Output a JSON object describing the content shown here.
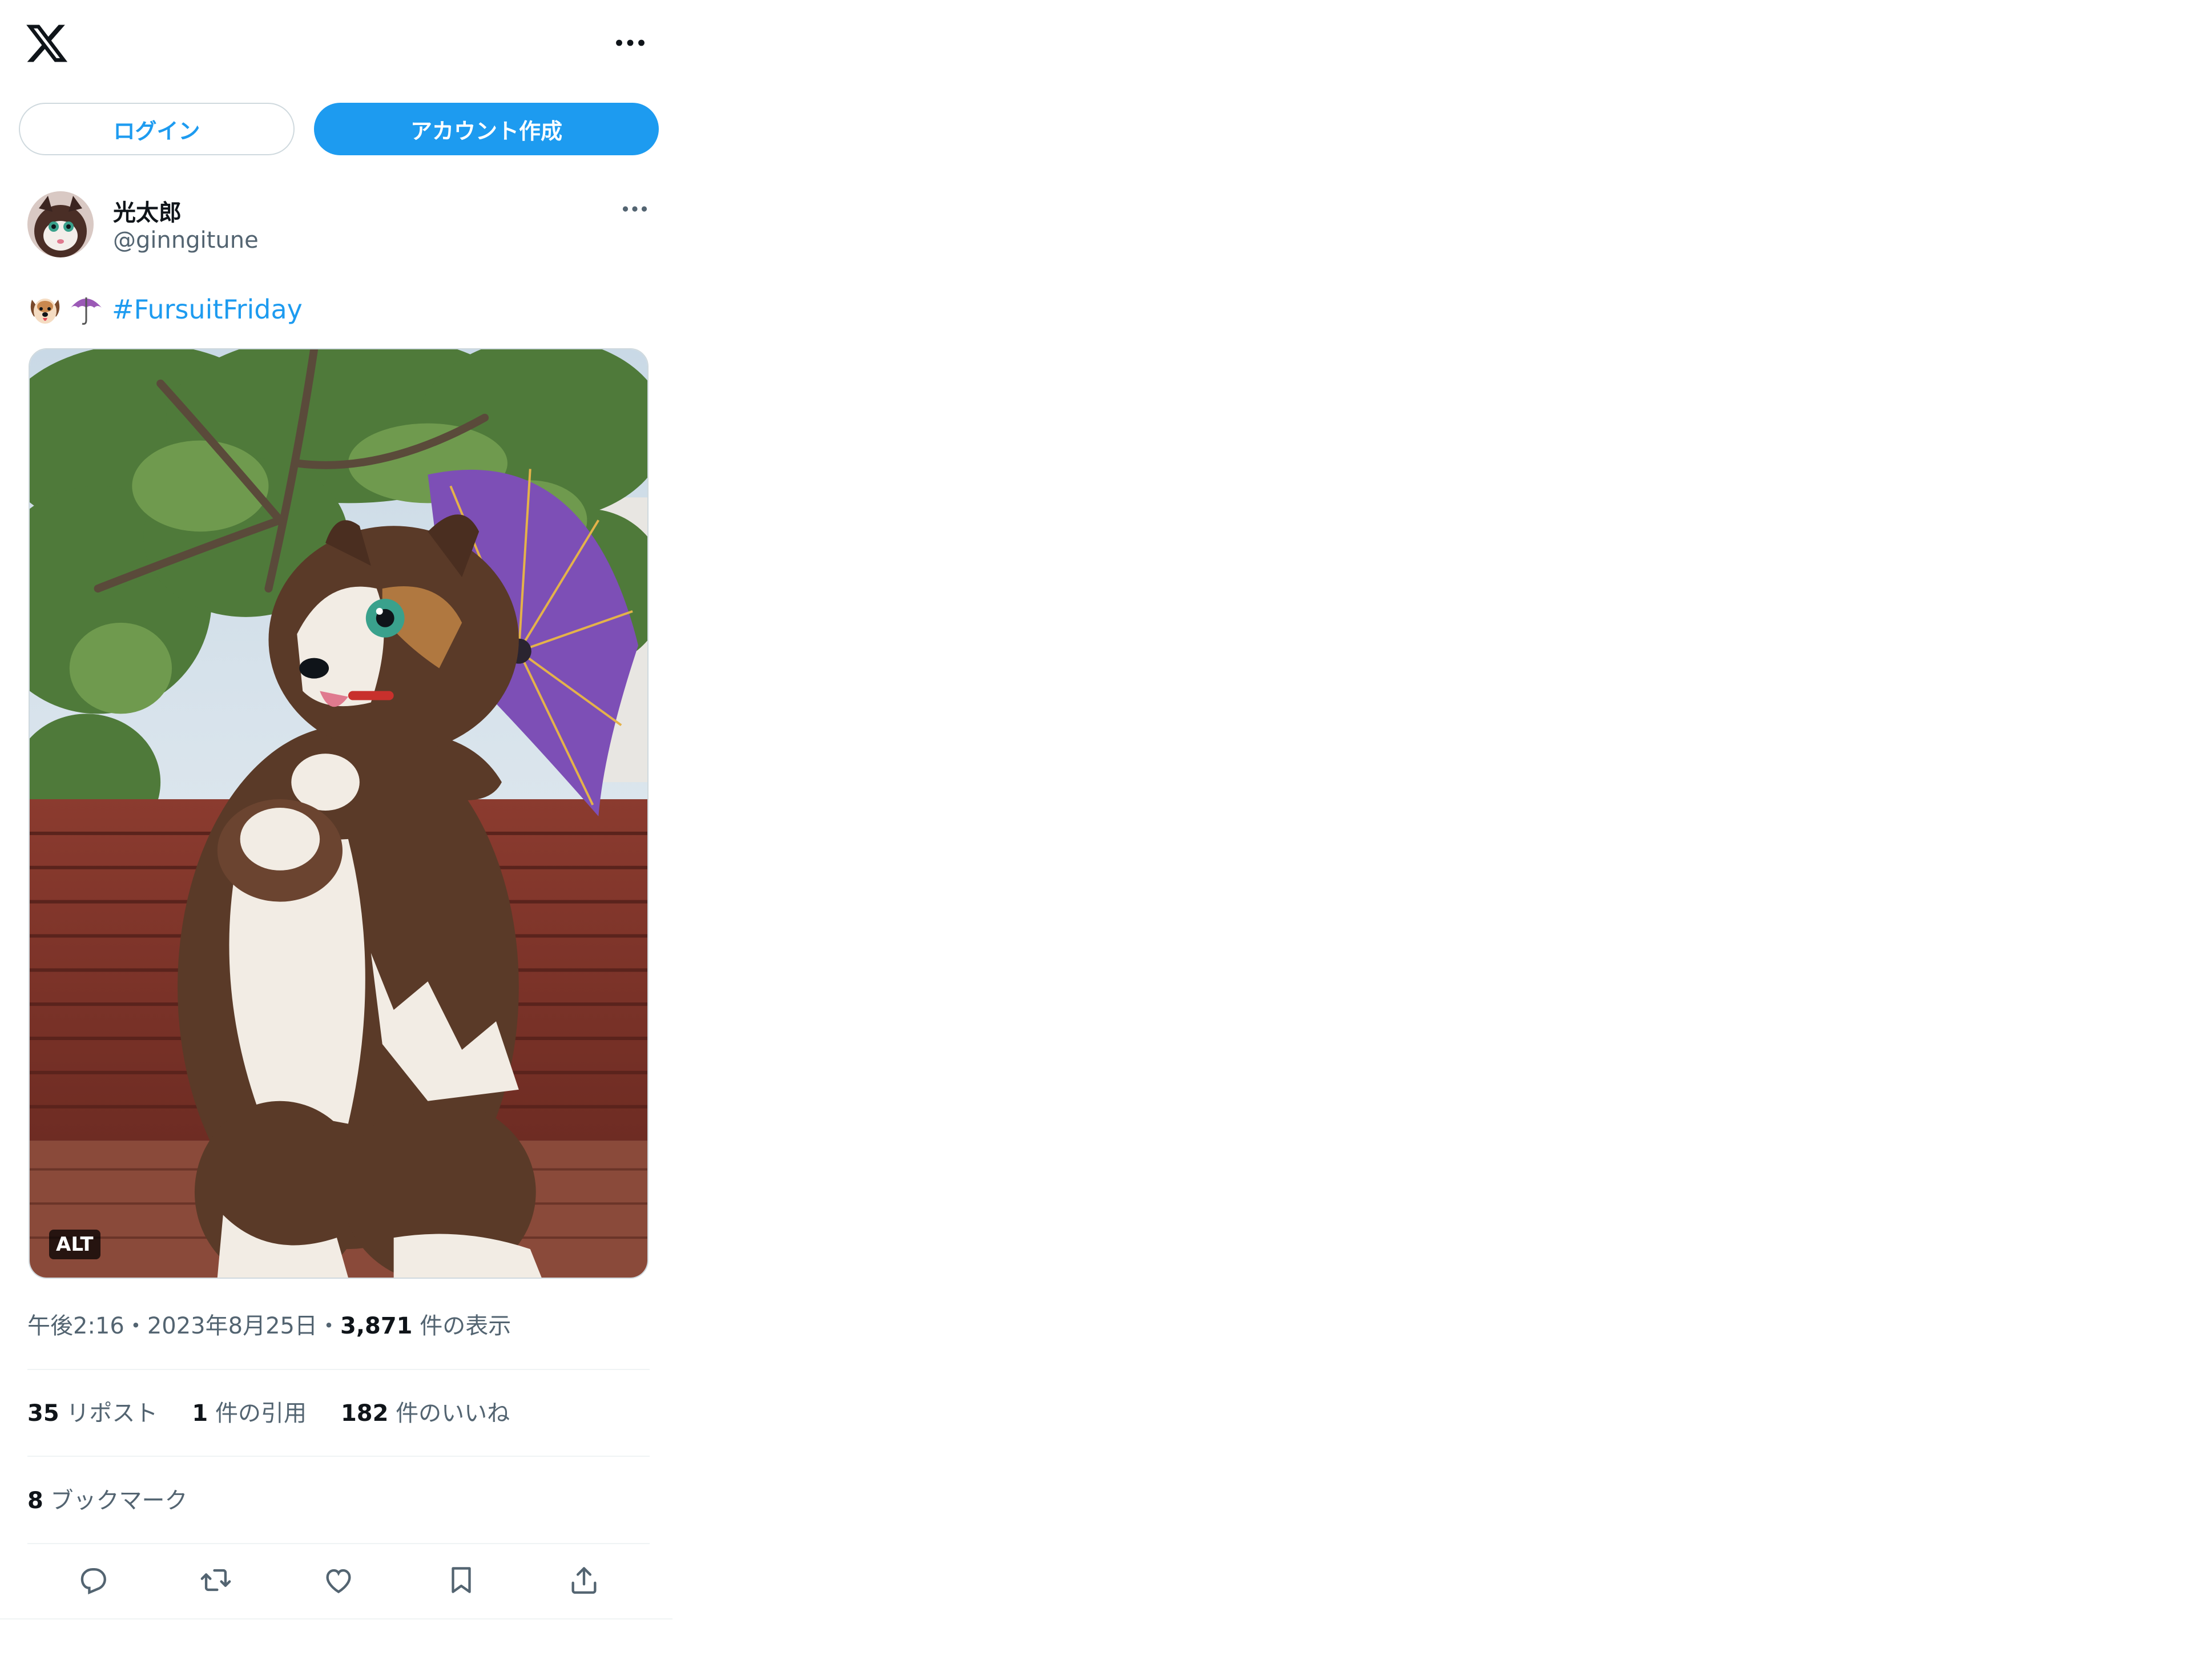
{
  "header": {
    "logo_icon": "x-logo-icon",
    "more_icon": "more-horizontal-icon"
  },
  "auth": {
    "login_label": "ログイン",
    "signup_label": "アカウント作成"
  },
  "author": {
    "display_name": "光太郎",
    "handle": "@ginngitune",
    "more_icon": "more-horizontal-icon"
  },
  "tweet": {
    "emojis": [
      "dog-face-emoji",
      "umbrella-emoji"
    ],
    "hashtag": "#FursuitFriday",
    "media_alt_badge": "ALT"
  },
  "meta": {
    "time": "午後2:16",
    "sep1": "・",
    "date": "2023年8月25日",
    "sep2": "・",
    "views_count": "3,871",
    "views_label": " 件の表示"
  },
  "stats": {
    "reposts_count": "35",
    "reposts_label": " リポスト",
    "quotes_count": "1",
    "quotes_label": " 件の引用",
    "likes_count": "182",
    "likes_label": " 件のいいね"
  },
  "bookmarks": {
    "count": "8",
    "label": " ブックマーク"
  },
  "actions": [
    "reply-icon",
    "repost-icon",
    "like-icon",
    "bookmark-icon",
    "share-icon"
  ],
  "colors": {
    "accent": "#1d9bf0",
    "text_primary": "#0f1419",
    "text_secondary": "#536471",
    "border": "#eff3f4"
  }
}
